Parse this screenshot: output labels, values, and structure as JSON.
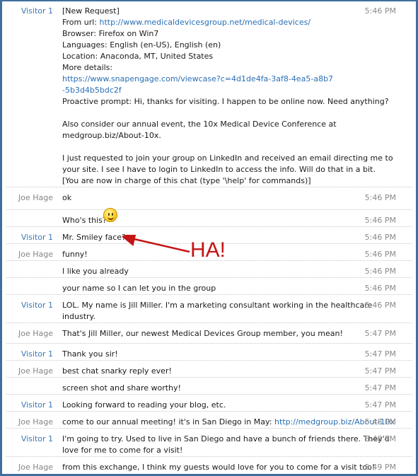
{
  "messages": [
    {
      "sender": "Visitor 1",
      "role": "visitor",
      "time": "5:46 PM",
      "lines": [
        {
          "text": "[New Request]"
        },
        {
          "prefix": "From url: ",
          "link": "http://www.medicaldevicesgroup.net/medical-devices/"
        },
        {
          "text": "Browser: Firefox on Win7"
        },
        {
          "text": "Languages: English (en-US), English (en)"
        },
        {
          "text": "Location: Anaconda, MT, United States"
        },
        {
          "text": "More details:"
        },
        {
          "link": "https://www.snapengage.com/viewcase?c=4d1de4fa-3af8-4ea5-a8b7"
        },
        {
          "link": "-5b3d4b5bdc2f"
        },
        {
          "text": "Proactive prompt: Hi, thanks for visiting. I happen to be online now. Need anything?"
        },
        {
          "text": ""
        },
        {
          "text": "Also consider our annual event, the 10x Medical Device Conference at"
        },
        {
          "text": "medgroup.biz/About-10x."
        },
        {
          "text": ""
        },
        {
          "text": "I just requested to join your group on LinkedIn and received an email directing me to"
        },
        {
          "text": "your site. I see I have to login to LinkedIn to access the info. Will do that in a bit."
        },
        {
          "text": "[You are now in charge of this chat (type '\\help' for commands)]"
        }
      ]
    },
    {
      "sender": "Joe Hage",
      "role": "agent",
      "time": "5:46 PM",
      "lines": [
        {
          "text": "ok"
        }
      ]
    },
    {
      "sender": "",
      "role": "agent",
      "time": "5:46 PM",
      "lines": [
        {
          "text": "Who's this?"
        }
      ],
      "emoticon": "smiley-icon"
    },
    {
      "sender": "Visitor 1",
      "role": "visitor",
      "time": "5:46 PM",
      "lines": [
        {
          "text": "Mr. Smiley face?"
        }
      ]
    },
    {
      "sender": "Joe Hage",
      "role": "agent",
      "time": "5:46 PM",
      "lines": [
        {
          "text": "funny!"
        }
      ]
    },
    {
      "sender": "",
      "role": "agent",
      "time": "5:46 PM",
      "lines": [
        {
          "text": "I like you already"
        }
      ]
    },
    {
      "sender": "",
      "role": "agent",
      "time": "5:46 PM",
      "lines": [
        {
          "text": "your name so I can let you in the group"
        }
      ]
    },
    {
      "sender": "Visitor 1",
      "role": "visitor",
      "time": "5:46 PM",
      "lines": [
        {
          "text": "LOL. My name is Jill Miller. I'm a marketing consultant working in the healthcare"
        },
        {
          "text": "industry."
        }
      ]
    },
    {
      "sender": "Joe Hage",
      "role": "agent",
      "time": "5:47 PM",
      "lines": [
        {
          "text": "That's Jill Miller, our newest Medical Devices Group member, you mean!"
        }
      ]
    },
    {
      "sender": "Visitor 1",
      "role": "visitor",
      "time": "5:47 PM",
      "lines": [
        {
          "text": "Thank you sir!"
        }
      ]
    },
    {
      "sender": "Joe Hage",
      "role": "agent",
      "time": "5:47 PM",
      "lines": [
        {
          "text": "best chat snarky reply ever!"
        }
      ]
    },
    {
      "sender": "",
      "role": "agent",
      "time": "5:47 PM",
      "lines": [
        {
          "text": "screen shot and share worthy!"
        }
      ]
    },
    {
      "sender": "Visitor 1",
      "role": "visitor",
      "time": "5:47 PM",
      "lines": [
        {
          "text": "Looking forward to reading your blog, etc."
        }
      ]
    },
    {
      "sender": "Joe Hage",
      "role": "agent",
      "time": "5:48 PM",
      "lines": [
        {
          "prefix": "come to our annual meeting! it's in San Diego in May: ",
          "link": "http://medgroup.biz/About-10x"
        }
      ]
    },
    {
      "sender": "Visitor 1",
      "role": "visitor",
      "time": "5:48 PM",
      "lines": [
        {
          "text": "I'm going to try. Used to live in San Diego and have a bunch of friends there. They'd"
        },
        {
          "text": "love for me to come for a visit!"
        }
      ]
    },
    {
      "sender": "Joe Hage",
      "role": "agent",
      "time": "5:49 PM",
      "lines": [
        {
          "text": "from this exchange, I think my guests would love for you to come for a visit too!"
        }
      ]
    }
  ],
  "annotation": {
    "text": "HA!",
    "color": "#c41414"
  },
  "colors": {
    "frame": "#3f6f9e",
    "visitor": "#3b78b8",
    "agent": "#858585",
    "link": "#2a6fb5"
  }
}
